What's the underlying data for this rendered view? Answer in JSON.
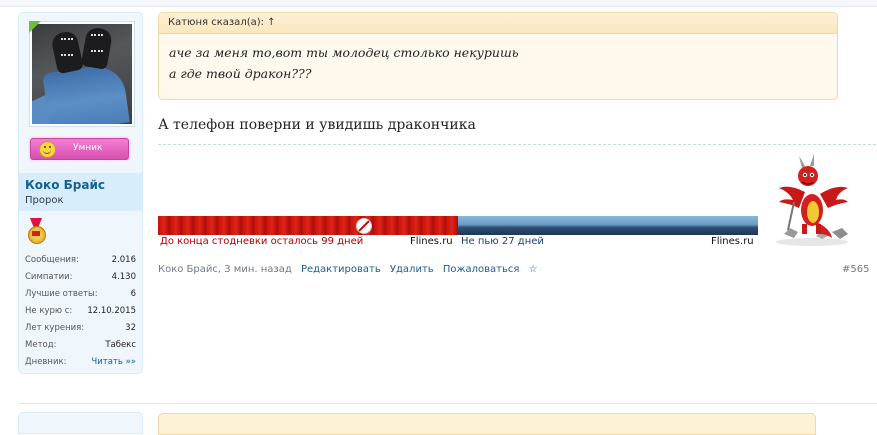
{
  "user": {
    "name": "Коко Брайс",
    "title": "Пророк",
    "rank_label": "Умник",
    "stats": [
      {
        "label": "Сообщения:",
        "value": "2.016"
      },
      {
        "label": "Симпатии:",
        "value": "4.130"
      },
      {
        "label": "Лучшие ответы:",
        "value": "6"
      },
      {
        "label": "Не курю с:",
        "value": "12.10.2015"
      },
      {
        "label": "Лет курения:",
        "value": "32"
      },
      {
        "label": "Метод:",
        "value": "Табекс"
      },
      {
        "label": "Дневник:",
        "value": "Читать »»"
      }
    ]
  },
  "quote": {
    "header": "Катюня сказал(а): ↑",
    "line1": "аче за меня то,вот ты молодец столько некуришь",
    "line2": "а где твой дракон???"
  },
  "message": "А телефон поверни и увидишь дракончика",
  "banner": {
    "left_text": "До конца стодневки осталось 99 дней",
    "left_site": "Flines.ru",
    "right_text": "Не пью  27 дней",
    "right_site": "Flines.ru"
  },
  "meta": {
    "author_time": "Коко Брайс, 3 мин. назад",
    "edit": "Редактировать",
    "delete": "Удалить",
    "report": "Пожаловаться",
    "star": "☆",
    "post_number": "#565"
  },
  "colors": {
    "link": "#176093",
    "banner_red_text": "#b10000",
    "banner_blue_text": "#1a3f7a"
  },
  "icons": [
    "no-smoking-icon",
    "medal-icon",
    "smiley-icon",
    "dragon-image"
  ]
}
